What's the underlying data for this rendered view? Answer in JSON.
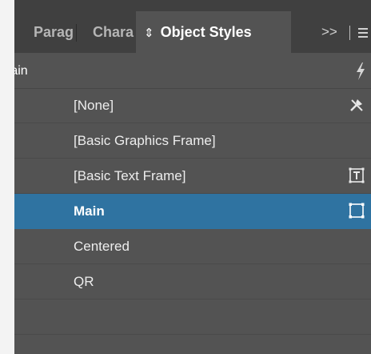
{
  "tabs": [
    {
      "label": "Paragraph Styles",
      "display": "Parag"
    },
    {
      "label": "Character Styles",
      "display": "Chara"
    },
    {
      "label": "Object Styles",
      "display": "Object Styles"
    }
  ],
  "tab_overflow": ">>",
  "panel": {
    "group_title": "Main"
  },
  "styles": [
    {
      "label": "[None]",
      "icon": "no-style-icon"
    },
    {
      "label": "[Basic Graphics Frame]",
      "icon": ""
    },
    {
      "label": "[Basic Text Frame]",
      "icon": "text-frame-icon"
    },
    {
      "label": "Main",
      "icon": "frame-icon",
      "selected": true
    },
    {
      "label": "Centered",
      "icon": ""
    },
    {
      "label": "QR",
      "icon": ""
    }
  ],
  "colors": {
    "panel_bg": "#535353",
    "tabbar_bg": "#404040",
    "selection": "#2f73a1"
  }
}
